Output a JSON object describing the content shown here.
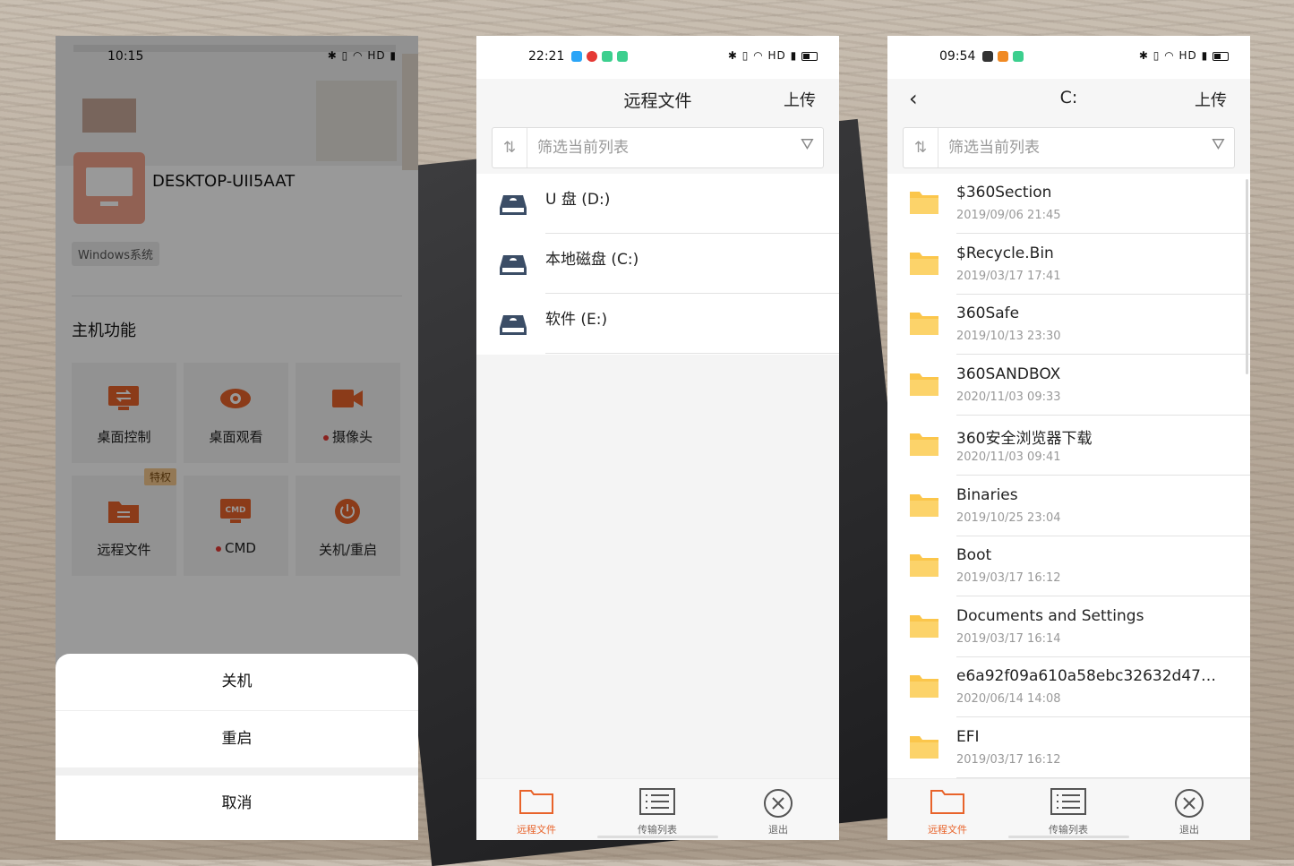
{
  "phone1": {
    "status_time": "10:15",
    "status_right": "HD",
    "device_name": "DESKTOP-UII5AAT",
    "os_tag": "Windows系统",
    "section_title": "主机功能",
    "grid": [
      {
        "label": "桌面控制",
        "icon": "desktop-transfer-icon"
      },
      {
        "label": "桌面观看",
        "icon": "eye-icon"
      },
      {
        "label": "摄像头",
        "icon": "camera-icon",
        "dot": true
      },
      {
        "label": "远程文件",
        "icon": "folder-icon",
        "badge": "特权"
      },
      {
        "label": "CMD",
        "icon": "cmd-icon",
        "dot": true
      },
      {
        "label": "关机/重启",
        "icon": "power-icon"
      }
    ],
    "sheet": {
      "shutdown": "关机",
      "restart": "重启",
      "cancel": "取消"
    }
  },
  "phone2": {
    "status_time": "22:21",
    "status_right": "HD",
    "title": "远程文件",
    "upload": "上传",
    "filter_placeholder": "筛选当前列表",
    "drives": [
      "U 盘 (D:)",
      "本地磁盘 (C:)",
      "软件 (E:)"
    ],
    "tabs": {
      "remote": "远程文件",
      "transfer": "传输列表",
      "exit": "退出"
    }
  },
  "phone3": {
    "status_time": "09:54",
    "status_right": "HD",
    "title": "C:",
    "upload": "上传",
    "filter_placeholder": "筛选当前列表",
    "files": [
      {
        "name": "$360Section",
        "date": "2019/09/06 21:45"
      },
      {
        "name": "$Recycle.Bin",
        "date": "2019/03/17 17:41"
      },
      {
        "name": "360Safe",
        "date": "2019/10/13 23:30"
      },
      {
        "name": "360SANDBOX",
        "date": "2020/11/03 09:33"
      },
      {
        "name": "360安全浏览器下载",
        "date": "2020/11/03 09:41"
      },
      {
        "name": "Binaries",
        "date": "2019/10/25 23:04"
      },
      {
        "name": "Boot",
        "date": "2019/03/17 16:12"
      },
      {
        "name": "Documents and Settings",
        "date": "2019/03/17 16:14"
      },
      {
        "name": "e6a92f09a610a58ebc32632d47…",
        "date": "2020/06/14 14:08"
      },
      {
        "name": "EFI",
        "date": "2019/03/17 16:12"
      }
    ],
    "tabs": {
      "remote": "远程文件",
      "transfer": "传输列表",
      "exit": "退出"
    }
  },
  "colors": {
    "accent": "#e8632a",
    "folder": "#fbc64b",
    "drive": "#3b4d66"
  }
}
